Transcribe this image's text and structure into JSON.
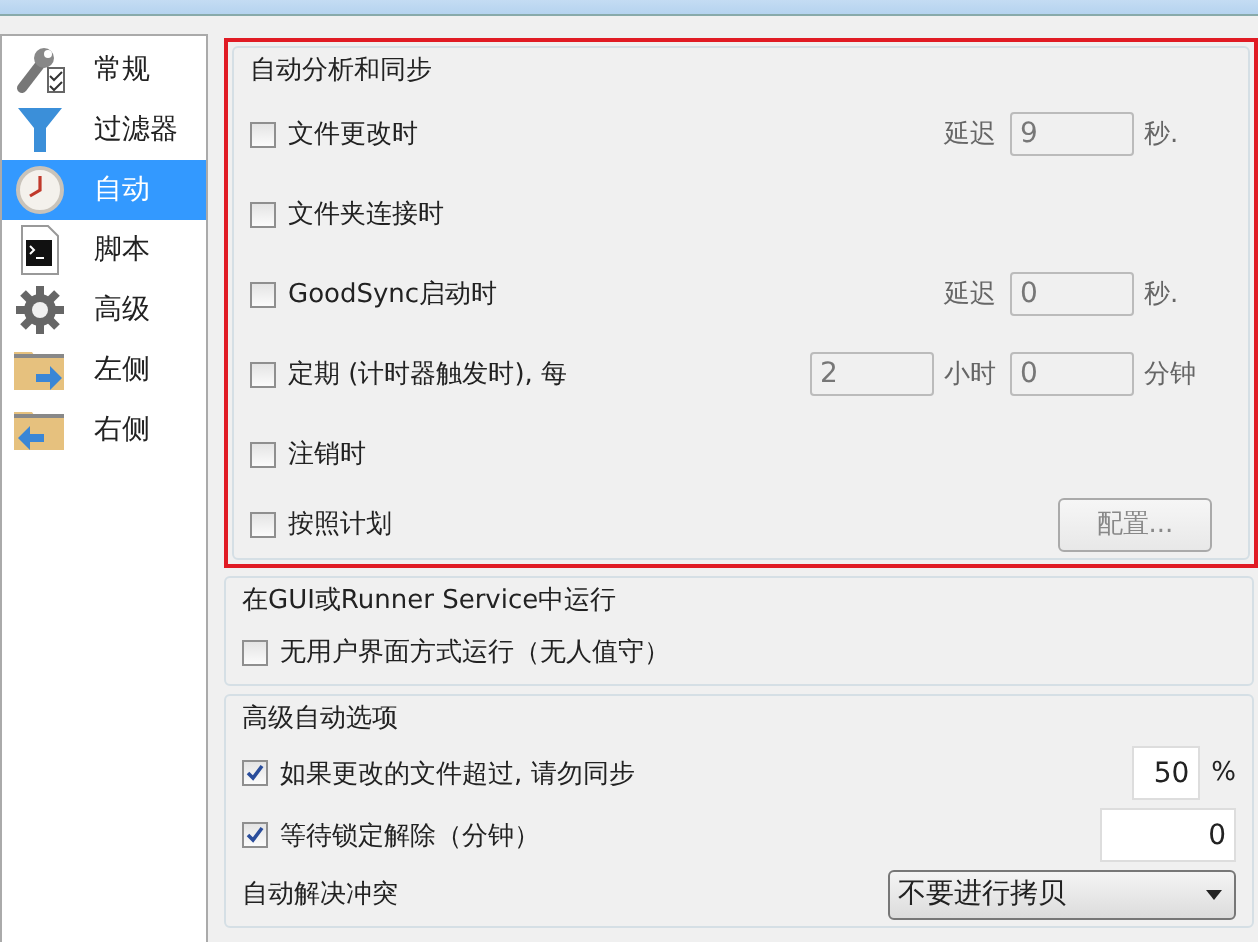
{
  "sidebar": {
    "items": [
      {
        "label": "常规",
        "selected": false
      },
      {
        "label": "过滤器",
        "selected": false
      },
      {
        "label": "自动",
        "selected": true
      },
      {
        "label": "脚本",
        "selected": false
      },
      {
        "label": "高级",
        "selected": false
      },
      {
        "label": "左侧",
        "selected": false
      },
      {
        "label": "右侧",
        "selected": false
      }
    ]
  },
  "auto_sync": {
    "title": "自动分析和同步",
    "rows": [
      {
        "label": "文件更改时",
        "checked": false,
        "extras": [
          {
            "kind": "label",
            "text": "延迟"
          },
          {
            "kind": "field",
            "value": "9",
            "disabled": true
          },
          {
            "kind": "label",
            "text": "秒."
          }
        ]
      },
      {
        "label": "文件夹连接时",
        "checked": false
      },
      {
        "label": "GoodSync启动时",
        "checked": false,
        "extras": [
          {
            "kind": "label",
            "text": "延迟"
          },
          {
            "kind": "field",
            "value": "0",
            "disabled": true
          },
          {
            "kind": "label",
            "text": "秒."
          }
        ]
      },
      {
        "label": "定期 (计时器触发时), 每",
        "checked": false,
        "extras": [
          {
            "kind": "field",
            "value": "2",
            "disabled": true
          },
          {
            "kind": "label",
            "text": "小时"
          },
          {
            "kind": "field",
            "value": "0",
            "disabled": true
          },
          {
            "kind": "label",
            "text": "分钟"
          }
        ]
      },
      {
        "label": "注销时",
        "checked": false
      },
      {
        "label": "按照计划",
        "checked": false,
        "extras": [
          {
            "kind": "button",
            "text": "配置...",
            "disabled": true
          }
        ]
      }
    ]
  },
  "runner": {
    "title": "在GUI或Runner Service中运行",
    "rows": [
      {
        "kind": "checkbox",
        "label": "无用户界面方式运行（无人值守）",
        "checked": false
      }
    ]
  },
  "advanced": {
    "title": "高级自动选项",
    "rows": [
      {
        "kind": "checkbox",
        "label": "如果更改的文件超过, 请勿同步",
        "checked": true,
        "value": "50",
        "unit": "%"
      },
      {
        "kind": "checkbox",
        "label": "等待锁定解除（分钟）",
        "checked": true,
        "value": "0"
      },
      {
        "kind": "dropdown",
        "label": "自动解决冲突",
        "value": "不要进行拷贝"
      }
    ]
  }
}
